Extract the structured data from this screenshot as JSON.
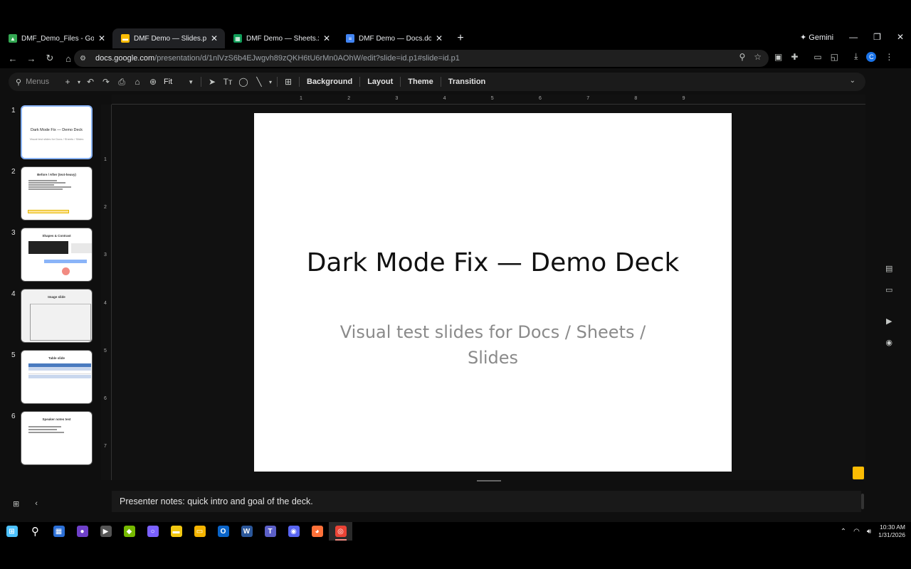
{
  "browser": {
    "tabs": [
      {
        "title": "DMF_Demo_Files - Google Drive",
        "icon": "drive-icon",
        "color": "#34a853",
        "active": false
      },
      {
        "title": "DMF Demo — Slides.pptx - Google Slides",
        "icon": "slides-icon",
        "color": "#fbbc04",
        "active": true
      },
      {
        "title": "DMF Demo — Sheets.xlsx - Google Sheets",
        "icon": "sheets-icon",
        "color": "#0f9d58",
        "active": false
      },
      {
        "title": "DMF Demo — Docs.docx - Google Docs",
        "icon": "docs-icon",
        "color": "#4285f4",
        "active": false
      }
    ],
    "gemini_label": "Gemini",
    "url_host": "docs.google.com",
    "url_path": "/presentation/d/1nlVzS6b4EJwgvh89zQKH6tU6rMn0AOhW/edit?slide=id.p1#slide=id.p1",
    "avatar_letter": "C"
  },
  "toolbar": {
    "menus_label": "Menus",
    "zoom_label": "Fit",
    "background_label": "Background",
    "layout_label": "Layout",
    "theme_label": "Theme",
    "transition_label": "Transition"
  },
  "filmstrip": [
    {
      "num": "1",
      "title": "Dark Mode Fix — Demo Deck",
      "sub": "Visual test slides for Docs / Sheets / Slides",
      "selected": true
    },
    {
      "num": "2",
      "title": "Before / After (text-heavy)",
      "selected": false
    },
    {
      "num": "3",
      "title": "Shapes & Contrast",
      "selected": false
    },
    {
      "num": "4",
      "title": "Image slide",
      "selected": false
    },
    {
      "num": "5",
      "title": "Table slide",
      "selected": false
    },
    {
      "num": "6",
      "title": "Speaker notes test",
      "selected": false
    }
  ],
  "rulers": {
    "top": [
      "1",
      "2",
      "3",
      "4",
      "5",
      "6",
      "7",
      "8",
      "9"
    ],
    "left": [
      "1",
      "2",
      "3",
      "4",
      "5",
      "6",
      "7"
    ]
  },
  "slide": {
    "title": "Dark Mode Fix — Demo Deck",
    "subtitle": "Visual test slides for Docs / Sheets / Slides"
  },
  "notes": {
    "text": "Presenter notes: quick intro and goal of the deck."
  },
  "taskbar": {
    "apps": [
      {
        "name": "windows-start-icon",
        "color": "#4cc2ff",
        "glyph": "⊞"
      },
      {
        "name": "search-icon",
        "color": "transparent",
        "glyph": "⚲"
      },
      {
        "name": "app-blue-icon",
        "color": "#2b6fd6",
        "glyph": "▦"
      },
      {
        "name": "github-icon",
        "color": "#6e40c9",
        "glyph": "●"
      },
      {
        "name": "media-player-icon",
        "color": "#555555",
        "glyph": "▶"
      },
      {
        "name": "nvidia-icon",
        "color": "#76b900",
        "glyph": "◆"
      },
      {
        "name": "cortana-icon",
        "color": "#7b61ff",
        "glyph": "○"
      },
      {
        "name": "sticky-notes-icon",
        "color": "#f2c811",
        "glyph": "▬"
      },
      {
        "name": "file-explorer-icon",
        "color": "#f4b400",
        "glyph": "▭"
      },
      {
        "name": "outlook-icon",
        "color": "#0a64c8",
        "glyph": "O"
      },
      {
        "name": "word-icon",
        "color": "#2b579a",
        "glyph": "W"
      },
      {
        "name": "teams-icon",
        "color": "#5b5fc7",
        "glyph": "T"
      },
      {
        "name": "discord-icon",
        "color": "#5865f2",
        "glyph": "◉"
      },
      {
        "name": "firefox-icon",
        "color": "#ff7139",
        "glyph": "◕"
      },
      {
        "name": "chrome-icon",
        "color": "#ea4335",
        "glyph": "◎"
      }
    ],
    "time": "10:30 AM",
    "date": "1/31/2026"
  }
}
